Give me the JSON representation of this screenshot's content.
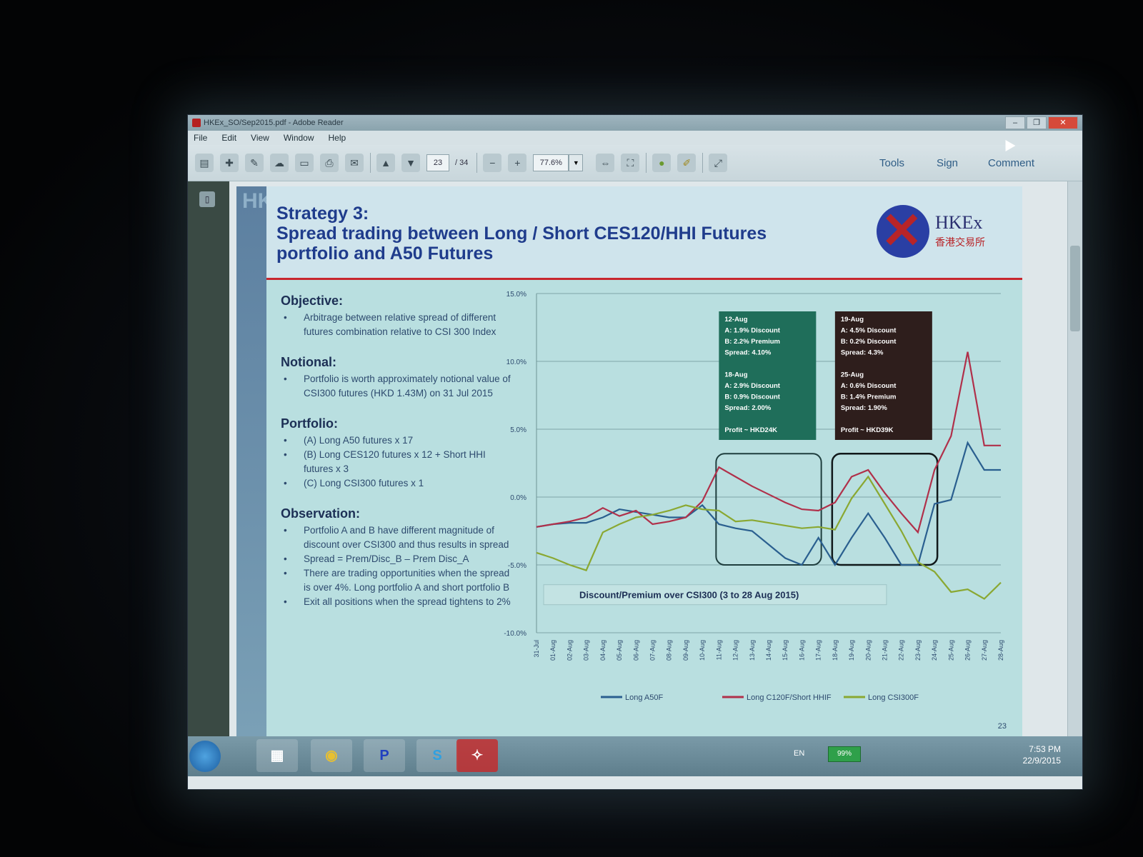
{
  "window": {
    "title": "HKEx_SO/Sep2015.pdf - Adobe Reader",
    "controls": [
      "–",
      "❐",
      "✕"
    ]
  },
  "menu": [
    "File",
    "Edit",
    "View",
    "Window",
    "Help"
  ],
  "toolbar": {
    "page_current": "23",
    "page_total": "/ 34",
    "zoom": "77.6%",
    "tools_label": "Tools",
    "sign_label": "Sign",
    "comment_label": "Comment"
  },
  "slide": {
    "side_letters": "HKEX",
    "title_line1": "Strategy 3:",
    "title_line2": "Spread trading between Long / Short CES120/HHI Futures",
    "title_line3": "portfolio and A50 Futures",
    "logo_text": "HKEx",
    "logo_sub": "香港交易所",
    "objective_heading": "Objective:",
    "objective_items": [
      "Arbitrage between relative spread of different futures combination relative to CSI 300 Index"
    ],
    "notional_heading": "Notional:",
    "notional_items": [
      "Portfolio is worth approximately notional value of CSI300 futures (HKD 1.43M) on 31 Jul 2015"
    ],
    "portfolio_heading": "Portfolio:",
    "portfolio_items": [
      "(A) Long A50 futures x 17",
      "(B) Long CES120 futures x 12 + Short HHI futures x 3",
      "(C) Long CSI300 futures x 1"
    ],
    "observation_heading": "Observation:",
    "observation_items": [
      "Portfolio A and B have different magnitude of discount over CSI300 and thus results in spread",
      "Spread = Prem/Disc_B – Prem Disc_A",
      "There are trading opportunities when the spread is over 4%. Long portfolio A and short portfolio B",
      "Exit all positions when the spread tightens to 2%"
    ],
    "page_number": "23"
  },
  "chart_data": {
    "type": "line",
    "title": "Discount/Premium over CSI300 (3 to 28 Aug 2015)",
    "categories": [
      "31-Jul",
      "01-Aug",
      "02-Aug",
      "03-Aug",
      "04-Aug",
      "05-Aug",
      "06-Aug",
      "07-Aug",
      "08-Aug",
      "09-Aug",
      "10-Aug",
      "11-Aug",
      "12-Aug",
      "13-Aug",
      "14-Aug",
      "15-Aug",
      "16-Aug",
      "17-Aug",
      "18-Aug",
      "19-Aug",
      "20-Aug",
      "21-Aug",
      "22-Aug",
      "23-Aug",
      "24-Aug",
      "25-Aug",
      "26-Aug",
      "27-Aug",
      "28-Aug"
    ],
    "ylim": [
      -10,
      15
    ],
    "yticks": [
      "15.0%",
      "10.0%",
      "5.0%",
      "0.0%",
      "-5.0%",
      "-10.0%"
    ],
    "series": [
      {
        "name": "Long A50F",
        "color": "#2a5f8f",
        "values": [
          -2.2,
          -2.0,
          -1.9,
          -1.9,
          -1.5,
          -0.9,
          -1.1,
          -1.3,
          -1.5,
          -1.5,
          -0.6,
          -2.0,
          -2.3,
          -2.5,
          -3.5,
          -4.5,
          -5.0,
          -3.0,
          -5.0,
          -3.0,
          -1.2,
          -3.0,
          -5.0,
          -5.0,
          -0.5,
          -0.2,
          4.0,
          2.0,
          2.0
        ]
      },
      {
        "name": "Long C120F/Short HHIF",
        "color": "#b0304a",
        "values": [
          -2.2,
          -2.0,
          -1.8,
          -1.5,
          -0.8,
          -1.4,
          -1.0,
          -2.0,
          -1.8,
          -1.5,
          -0.3,
          2.2,
          1.5,
          0.8,
          0.2,
          -0.4,
          -0.9,
          -1.0,
          -0.4,
          1.5,
          2.0,
          0.3,
          -1.2,
          -2.6,
          2.0,
          4.5,
          10.7,
          3.8,
          3.8
        ]
      },
      {
        "name": "Long CSI300F",
        "color": "#8aa832",
        "values": [
          -4.1,
          -4.5,
          -5.0,
          -5.4,
          -2.6,
          -2.0,
          -1.5,
          -1.3,
          -1.0,
          -0.6,
          -0.9,
          -1.0,
          -1.8,
          -1.7,
          -1.9,
          -2.1,
          -2.3,
          -2.2,
          -2.4,
          -0.1,
          1.5,
          -0.5,
          -2.5,
          -4.8,
          -5.5,
          -7.0,
          -6.8,
          -7.5,
          -6.3
        ]
      }
    ],
    "annotations": [
      {
        "lines": [
          "12-Aug",
          "A: 1.9% Discount",
          "B: 2.2% Premium",
          "Spread: 4.10%",
          "",
          "18-Aug",
          "A: 2.9% Discount",
          "B: 0.9% Discount",
          "Spread: 2.00%",
          "",
          "Profit ~ HKD24K"
        ],
        "bg": "#1f6e5a"
      },
      {
        "lines": [
          "19-Aug",
          "A: 4.5% Discount",
          "B: 0.2% Discount",
          "Spread: 4.3%",
          "",
          "25-Aug",
          "A: 0.6% Discount",
          "B: 1.4% Premium",
          "Spread: 1.90%",
          "",
          "Profit ~ HKD39K"
        ],
        "bg": "#2e1e1c"
      }
    ]
  },
  "taskbar": {
    "lang": "EN",
    "battery": "99%",
    "time": "7:53 PM",
    "date": "22/9/2015",
    "apps": [
      "explorer",
      "chrome",
      "P",
      "skype",
      "acrobat"
    ]
  }
}
